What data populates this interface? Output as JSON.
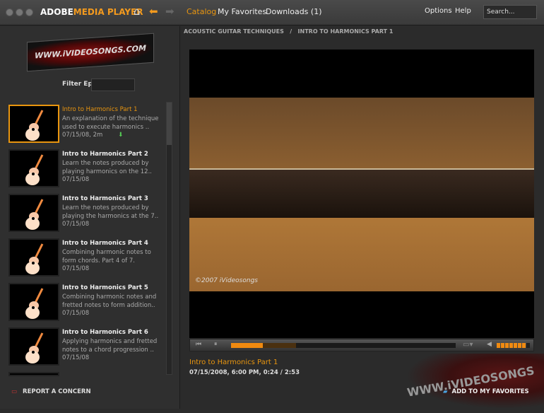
{
  "app": {
    "brand_a": "ADOBE",
    "brand_b": "MEDIA PLAYER"
  },
  "nav": {
    "catalog": "Catalog",
    "favorites": "My Favorites",
    "downloads": "Downloads (1)",
    "options": "Options",
    "help": "Help",
    "search_placeholder": "Search..."
  },
  "sidebar": {
    "logo_text": "WWW.iVIDEOSONGS.COM",
    "filter_label": "Filter Episodes",
    "report": "REPORT A CONCERN",
    "items": [
      {
        "title": "Intro to Harmonics Part 1",
        "desc": "An explanation of the technique used to execute harmonics ..",
        "date": "07/15/08, 2m"
      },
      {
        "title": "Intro to Harmonics Part 2",
        "desc": "Learn the notes produced by playing harmonics on the 12..",
        "date": "07/15/08"
      },
      {
        "title": "Intro to Harmonics Part 3",
        "desc": "Learn the notes produced by playing the harmonics at the 7..",
        "date": "07/15/08"
      },
      {
        "title": "Intro to Harmonics Part 4",
        "desc": "Combining harmonic notes to form chords. Part 4 of 7.",
        "date": "07/15/08"
      },
      {
        "title": "Intro to Harmonics Part 5",
        "desc": "Combining harmonic notes and fretted notes to form addition..",
        "date": "07/15/08"
      },
      {
        "title": "Intro to Harmonics Part 6",
        "desc": "Applying harmonics and fretted notes to a chord progression ..",
        "date": "07/15/08"
      }
    ]
  },
  "breadcrumb": {
    "parent": "ACOUSTIC GUITAR TECHNIQUES",
    "sep": "/",
    "current": "INTRO TO HARMONICS PART 1"
  },
  "video": {
    "copyright": "©2007 iVideosongs",
    "played_pct": 14,
    "buffered_pct": 29,
    "volume_level": 7,
    "volume_max": 8
  },
  "info": {
    "title": "Intro to Harmonics Part 1",
    "meta": "07/15/2008, 6:00 PM,  0:24 / 2:53",
    "watermark": "WWW.iVIDEOSONGS",
    "add_favorites": "ADD TO MY FAVORITES"
  },
  "colors": {
    "accent": "#e8950f"
  }
}
